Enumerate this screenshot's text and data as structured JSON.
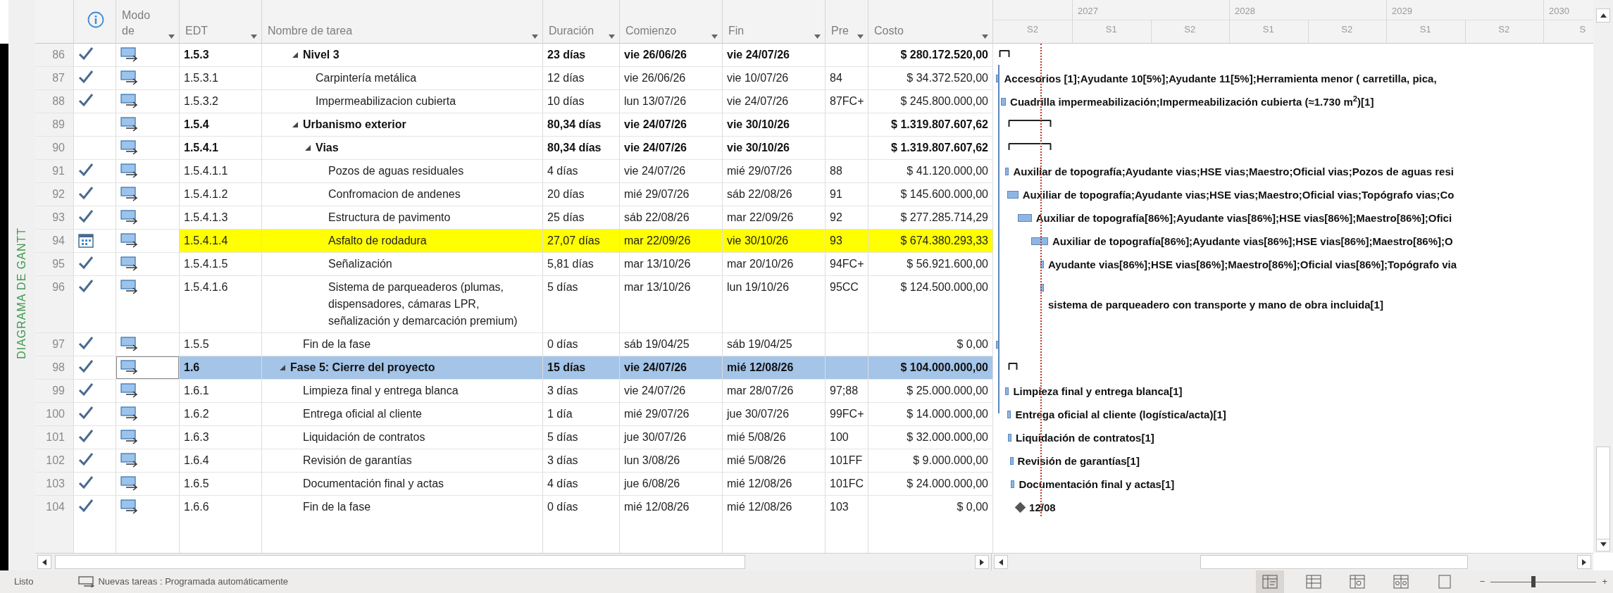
{
  "view_label": "DIAGRAMA DE GANTT",
  "columns": [
    "Modo de",
    "EDT",
    "Nombre de tarea",
    "Duración",
    "Comienzo",
    "Fin",
    "Pre",
    "Costo"
  ],
  "timescale": {
    "years": [
      "2027",
      "2028",
      "2029",
      "2030"
    ],
    "halves": [
      "S2",
      "S1",
      "S2",
      "S1",
      "S2",
      "S1",
      "S2",
      "S"
    ]
  },
  "rows": [
    {
      "number": "86",
      "edt": "1.5.3",
      "name": "Nivel 3",
      "duration": "23 días",
      "start": "vie 26/06/26",
      "finish": "vie 24/07/26",
      "cost": "$ 280.172.520,00",
      "completed": true,
      "constrained": false,
      "expanded": true,
      "selected": false,
      "highlighted": false,
      "children": [
        {
          "number": "87",
          "edt": "1.5.3.1",
          "name": "Carpintería metálica",
          "duration": "12 días",
          "start": "vie 26/06/26",
          "finish": "vie 10/07/26",
          "predecessors": "84",
          "cost": "$ 34.372.520,00",
          "completed": true,
          "constrained": false,
          "selected": false,
          "highlighted": false,
          "gantt_label": "Accesorios [1];Ayudante 10[5%];Ayudante 11[5%];Herramienta menor ( carretilla, pica,"
        },
        {
          "number": "88",
          "edt": "1.5.3.2",
          "name": "Impermeabilizacion cubierta",
          "duration": "10 días",
          "start": "lun 13/07/26",
          "finish": "vie 24/07/26",
          "predecessors": "87FC+",
          "cost": "$ 245.800.000,00",
          "completed": true,
          "constrained": false,
          "selected": false,
          "highlighted": false,
          "gantt_label": "Cuadrilla impermeabilización;Impermeabilización cubierta (≈1.730 m$^{2}$)[1]"
        }
      ]
    },
    {
      "number": "89",
      "edt": "1.5.4",
      "name": "Urbanismo exterior",
      "duration": "80,34 días",
      "start": "vie 24/07/26",
      "finish": "vie 30/10/26",
      "cost": "$ 1.319.807.607,62",
      "completed": false,
      "constrained": false,
      "expanded": true,
      "selected": false,
      "highlighted": false,
      "children": [
        {
          "number": "90",
          "edt": "1.5.4.1",
          "name": "Vias",
          "duration": "80,34 días",
          "start": "vie 24/07/26",
          "finish": "vie 30/10/26",
          "cost": "$ 1.319.807.607,62",
          "completed": false,
          "constrained": false,
          "expanded": true,
          "selected": false,
          "highlighted": false,
          "children": [
            {
              "number": "91",
              "edt": "1.5.4.1.1",
              "name": "Pozos de aguas residuales",
              "duration": "4 días",
              "start": "vie 24/07/26",
              "finish": "mié 29/07/26",
              "predecessors": "88",
              "cost": "$ 41.120.000,00",
              "completed": true,
              "constrained": false,
              "selected": false,
              "highlighted": false,
              "gantt_label": "Auxiliar de topografía;Ayudante vias;HSE vias;Maestro;Oficial vias;Pozos de aguas resi"
            },
            {
              "number": "92",
              "edt": "1.5.4.1.2",
              "name": "Confromacion de andenes",
              "duration": "20 días",
              "start": "mié 29/07/26",
              "finish": "sáb 22/08/26",
              "predecessors": "91",
              "cost": "$ 145.600.000,00",
              "completed": true,
              "constrained": false,
              "selected": false,
              "highlighted": false,
              "gantt_label": "Auxiliar de topografía;Ayudante vias;HSE vias;Maestro;Oficial vias;Topógrafo vias;Co"
            },
            {
              "number": "93",
              "edt": "1.5.4.1.3",
              "name": "Estructura de pavimento",
              "duration": "25 días",
              "start": "sáb 22/08/26",
              "finish": "mar 22/09/26",
              "predecessors": "92",
              "cost": "$ 277.285.714,29",
              "completed": true,
              "constrained": false,
              "selected": false,
              "highlighted": false,
              "gantt_label": "Auxiliar de topografía[86%];Ayudante vias[86%];HSE vias[86%];Maestro[86%];Ofici"
            },
            {
              "number": "94",
              "edt": "1.5.4.1.4",
              "name": "Asfalto de rodadura",
              "duration": "27,07 días",
              "start": "mar 22/09/26",
              "finish": "vie 30/10/26",
              "predecessors": "93",
              "cost": "$ 674.380.293,33",
              "completed": false,
              "constrained": true,
              "selected": false,
              "highlighted": true,
              "gantt_label": "Auxiliar de topografía[86%];Ayudante vias[86%];HSE vias[86%];Maestro[86%];O"
            },
            {
              "number": "95",
              "edt": "1.5.4.1.5",
              "name": "Señalización",
              "duration": "5,81 días",
              "start": "mar 13/10/26",
              "finish": "mar 20/10/26",
              "predecessors": "94FC+",
              "cost": "$ 56.921.600,00",
              "completed": true,
              "constrained": false,
              "selected": false,
              "highlighted": false,
              "gantt_label": "Ayudante vias[86%];HSE vias[86%];Maestro[86%];Oficial vias[86%];Topógrafo via"
            },
            {
              "number": "96",
              "edt": "1.5.4.1.6",
              "name": "Sistema de parqueaderos (plumas, dispensadores, cámaras LPR, señalización y demarcación premium)",
              "duration": "5 días",
              "start": "mar 13/10/26",
              "finish": "lun 19/10/26",
              "predecessors": "95CC",
              "cost": "$ 124.500.000,00",
              "completed": true,
              "constrained": false,
              "selected": false,
              "highlighted": false,
              "gantt_label": "sistema de parqueadero con transporte y mano de obra incluida[1]"
            }
          ]
        }
      ]
    },
    {
      "number": "97",
      "edt": "1.5.5",
      "name": "Fin de la fase",
      "duration": "0 días",
      "start": "sáb 19/04/25",
      "finish": "sáb 19/04/25",
      "cost": "$ 0,00",
      "completed": true,
      "constrained": false,
      "selected": false,
      "highlighted": false
    },
    {
      "number": "98",
      "edt": "1.6",
      "name": "Fase 5: Cierre del proyecto",
      "duration": "15 días",
      "start": "vie 24/07/26",
      "finish": "mié 12/08/26",
      "cost": "$ 104.000.000,00",
      "completed": true,
      "constrained": false,
      "expanded": true,
      "selected": true,
      "highlighted": false,
      "children": [
        {
          "number": "99",
          "edt": "1.6.1",
          "name": "Limpieza final y entrega blanca",
          "duration": "3 días",
          "start": "vie 24/07/26",
          "finish": "mar 28/07/26",
          "predecessors": "97;88",
          "cost": "$ 25.000.000,00",
          "completed": true,
          "constrained": false,
          "selected": false,
          "highlighted": false,
          "gantt_label": "Limpieza final y entrega blanca[1]"
        },
        {
          "number": "100",
          "edt": "1.6.2",
          "name": "Entrega oficial al cliente",
          "duration": "1 día",
          "start": "mié 29/07/26",
          "finish": "jue 30/07/26",
          "predecessors": "99FC+",
          "cost": "$ 14.000.000,00",
          "completed": true,
          "constrained": false,
          "selected": false,
          "highlighted": false,
          "gantt_label": "Entrega oficial al cliente (logística/acta)[1]"
        },
        {
          "number": "101",
          "edt": "1.6.3",
          "name": "Liquidación de contratos",
          "duration": "5 días",
          "start": "jue 30/07/26",
          "finish": "mié 5/08/26",
          "predecessors": "100",
          "cost": "$ 32.000.000,00",
          "completed": true,
          "constrained": false,
          "selected": false,
          "highlighted": false,
          "gantt_label": "Liquidación de contratos[1]"
        },
        {
          "number": "102",
          "edt": "1.6.4",
          "name": "Revisión de garantías",
          "duration": "3 días",
          "start": "lun 3/08/26",
          "finish": "mié 5/08/26",
          "predecessors": "101FF",
          "cost": "$ 9.000.000,00",
          "completed": true,
          "constrained": false,
          "selected": false,
          "highlighted": false,
          "gantt_label": "Revisión de garantías[1]"
        },
        {
          "number": "103",
          "edt": "1.6.5",
          "name": "Documentación final y actas",
          "duration": "4 días",
          "start": "jue 6/08/26",
          "finish": "mié 12/08/26",
          "predecessors": "101FC",
          "cost": "$ 24.000.000,00",
          "completed": true,
          "constrained": false,
          "selected": false,
          "highlighted": false,
          "gantt_label": "Documentación final y actas[1]"
        },
        {
          "number": "104",
          "edt": "1.6.6",
          "name": "Fin de la fase",
          "duration": "0 días",
          "start": "mié 12/08/26",
          "finish": "mié 12/08/26",
          "predecessors": "103",
          "cost": "$ 0,00",
          "completed": true,
          "constrained": false,
          "milestone": true,
          "selected": false,
          "highlighted": false,
          "gantt_label": "12/08"
        }
      ]
    }
  ],
  "status_bar": {
    "state": "Listo",
    "new_tasks": "Nuevas tareas : Programada automáticamente",
    "views": [
      {
        "selected": true
      },
      {
        "selected": false
      },
      {
        "selected": false
      },
      {
        "selected": false
      },
      {
        "selected": false
      }
    ],
    "zoom_out": "−",
    "zoom": {
      "level": 0.4
    },
    "zoom_in": "+"
  }
}
